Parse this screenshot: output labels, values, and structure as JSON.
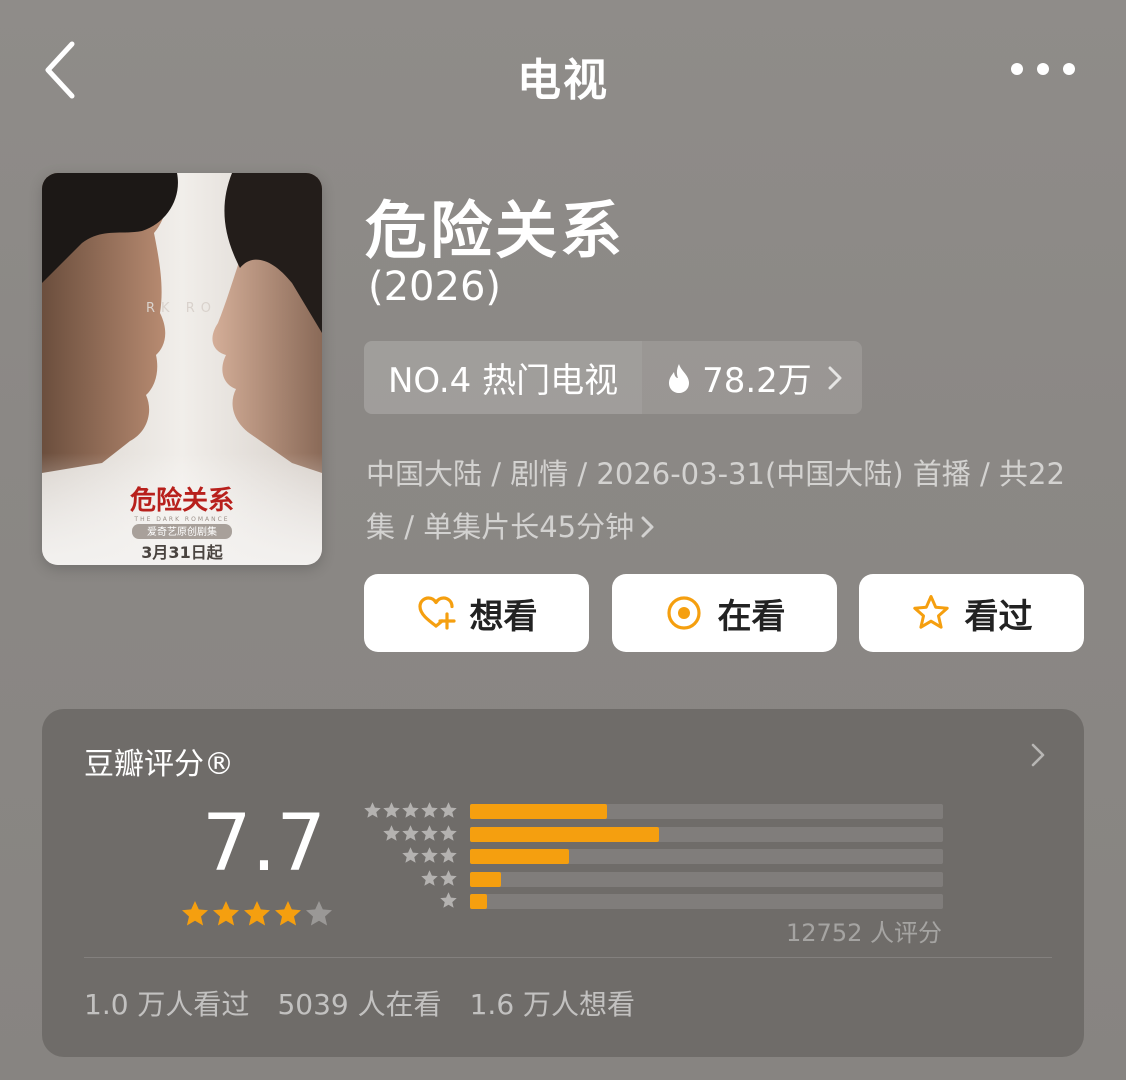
{
  "nav": {
    "title": "电视"
  },
  "poster": {
    "title_cn": "危险关系",
    "overlay_text": "RK RO",
    "subtitle": "THE DARK ROMANCE",
    "platform": "爱奇艺原创剧集",
    "release": "3月31日起"
  },
  "show": {
    "title": "危险关系",
    "year": "(2026)",
    "rank_label": "NO.4 热门电视",
    "heat": "78.2万",
    "meta": "中国大陆 / 剧情 / 2026-03-31(中国大陆) 首播 / 共22集 / 单集片长45分钟"
  },
  "actions": {
    "want": "想看",
    "watching": "在看",
    "watched": "看过"
  },
  "rating": {
    "header": "豆瓣评分®",
    "score": "7.7",
    "stars_filled": 4,
    "stars_total": 5,
    "distribution": [
      {
        "stars": 5,
        "fraction": 0.29
      },
      {
        "stars": 4,
        "fraction": 0.4
      },
      {
        "stars": 3,
        "fraction": 0.21
      },
      {
        "stars": 2,
        "fraction": 0.065
      },
      {
        "stars": 1,
        "fraction": 0.035
      }
    ],
    "count_text": "12752 人评分",
    "stat_watched": "1.0 万人看过",
    "stat_watching": "5039 人在看",
    "stat_want": "1.6 万人想看"
  },
  "colors": {
    "accent": "#f59f0f",
    "background": "#8c8986",
    "card": "#6f6c69"
  }
}
